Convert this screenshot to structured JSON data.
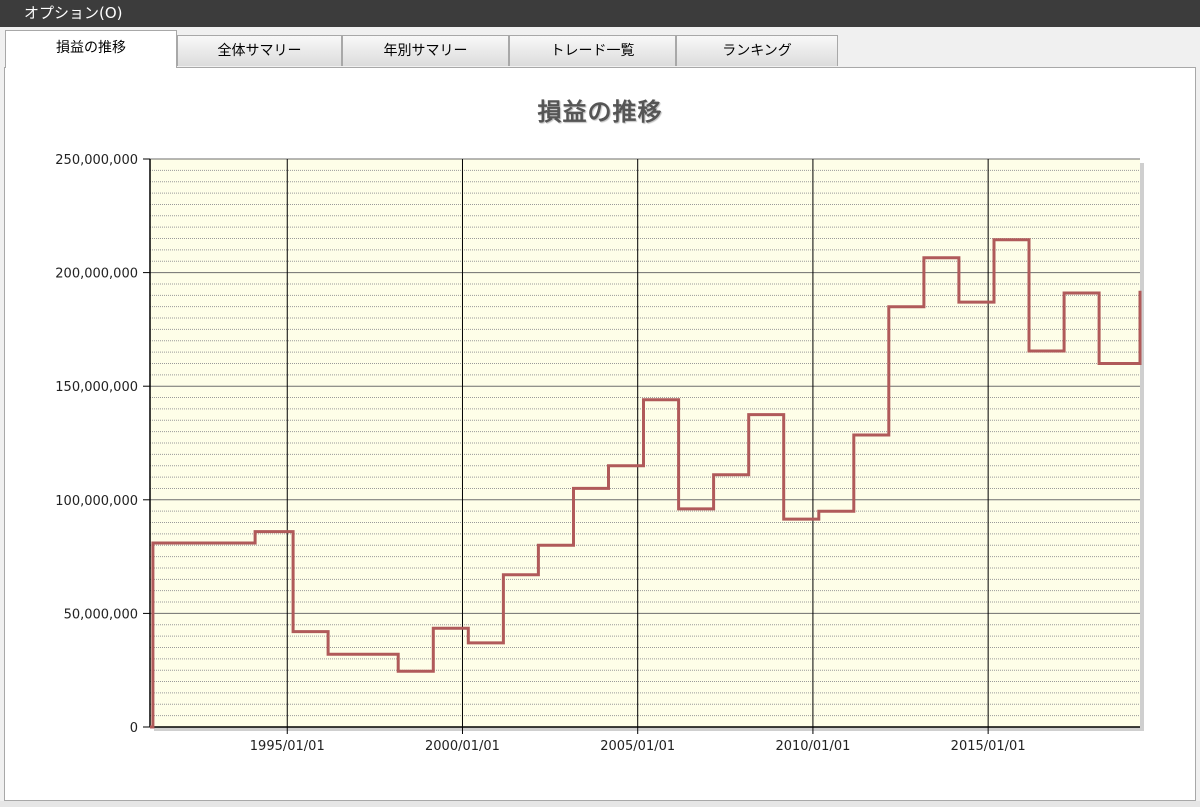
{
  "menubar": {
    "option_label": "オプション(O)"
  },
  "tabs": [
    {
      "label": "損益の推移",
      "active": true
    },
    {
      "label": "全体サマリー",
      "active": false
    },
    {
      "label": "年別サマリー",
      "active": false
    },
    {
      "label": "トレード一覧",
      "active": false
    },
    {
      "label": "ランキング",
      "active": false
    }
  ],
  "colors": {
    "series": "#b05a5a",
    "plot_bg": "#fefee8",
    "grid_major": "#6e6e6e",
    "grid_minor": "#9a9a9a"
  },
  "chart_data": {
    "type": "line",
    "title": "損益の推移",
    "xlabel": "",
    "ylabel": "",
    "ylim": [
      0,
      250000000
    ],
    "y_ticks": [
      "0",
      "50,000,000",
      "100,000,000",
      "150,000,000",
      "200,000,000",
      "250,000,000"
    ],
    "x_ticks": [
      "1995/01/01",
      "2000/01/01",
      "2005/01/01",
      "2010/01/01",
      "2015/01/01"
    ],
    "xlim": [
      "1991/02",
      "2019/05"
    ],
    "grid": true,
    "series": [
      {
        "step": true,
        "x": [
          "1991/02",
          "1991/03",
          "1994/02",
          "1995/03",
          "1996/03",
          "1997/03",
          "1998/03",
          "1999/03",
          "2000/03",
          "2001/03",
          "2002/03",
          "2003/03",
          "2004/03",
          "2005/03",
          "2006/03",
          "2007/03",
          "2008/03",
          "2009/03",
          "2010/03",
          "2011/03",
          "2012/03",
          "2013/03",
          "2014/03",
          "2015/03",
          "2016/03",
          "2017/03",
          "2018/03",
          "2019/05"
        ],
        "values": [
          0,
          81000000,
          86000000,
          42000000,
          32000000,
          32000000,
          24500000,
          43500000,
          37000000,
          67000000,
          80000000,
          105000000,
          115000000,
          144000000,
          96000000,
          111000000,
          137500000,
          91500000,
          95000000,
          128500000,
          185000000,
          206500000,
          187000000,
          214500000,
          165500000,
          191000000,
          160000000,
          192000000
        ]
      }
    ]
  }
}
